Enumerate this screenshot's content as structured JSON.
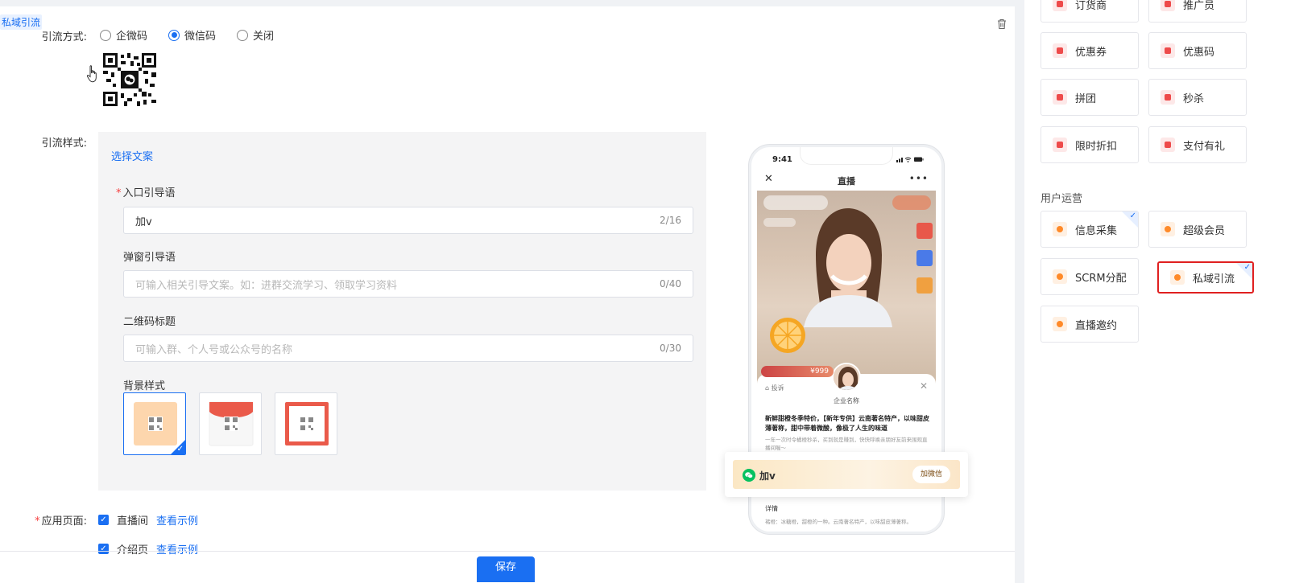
{
  "block_tag": "私域引流",
  "form": {
    "method_label": "引流方式:",
    "methods": [
      "企微码",
      "微信码",
      "关闭"
    ],
    "selected_method": "微信码",
    "style_label": "引流样式:",
    "select_copy_link": "选择文案",
    "entry_label": "入口引导语",
    "entry_value": "加v",
    "entry_count": "2/16",
    "popup_label": "弹窗引导语",
    "popup_placeholder": "可输入相关引导文案。如：进群交流学习、领取学习资料",
    "popup_count": "0/40",
    "qr_title_label": "二维码标题",
    "qr_title_placeholder": "可输入群、个人号或公众号的名称",
    "qr_title_count": "0/30",
    "bg_label": "背景样式",
    "bg_selected_index": 0,
    "apply_label": "应用页面:",
    "apply_pages": [
      {
        "name": "直播间",
        "link": "查看示例",
        "checked": true
      },
      {
        "name": "介绍页",
        "link": "查看示例",
        "checked": true
      }
    ],
    "save_label": "保存"
  },
  "preview": {
    "time": "9:41",
    "title": "直播",
    "company": "企业名称",
    "report": "投诉",
    "headline": "新鲜甜橙冬季特价，【新年专供】云南著名特产，以味甜皮薄著称，甜中带着微酸，像极了人生的味道",
    "sub": "一年一次时令橘橙秒杀，买到就是赚到，快快呼唤亲朋好友前来围观直播间喔～",
    "detail": "详情",
    "detail_text": "褚橙：冰糖橙，甜橙的一种。云南著名特产，以味甜皮薄著称。",
    "price": "¥999",
    "banner_text": "加v",
    "banner_btn": "加微信"
  },
  "right_panel": {
    "top_items": [
      "订货商",
      "推广员",
      "优惠券",
      "优惠码",
      "拼团",
      "秒杀",
      "限时折扣",
      "支付有礼"
    ],
    "section_title": "用户运营",
    "ops_items": [
      {
        "label": "信息采集",
        "checked": true
      },
      {
        "label": "超级会员",
        "checked": false
      },
      {
        "label": "SCRM分配",
        "checked": false
      },
      {
        "label": "私域引流",
        "checked": true,
        "active": true
      },
      {
        "label": "直播邀约",
        "checked": false
      }
    ]
  },
  "colors": {
    "primary": "#1a6ff2",
    "danger": "#e02020",
    "accent_red": "#ee4b4b",
    "accent_orange": "#ff8a29"
  }
}
